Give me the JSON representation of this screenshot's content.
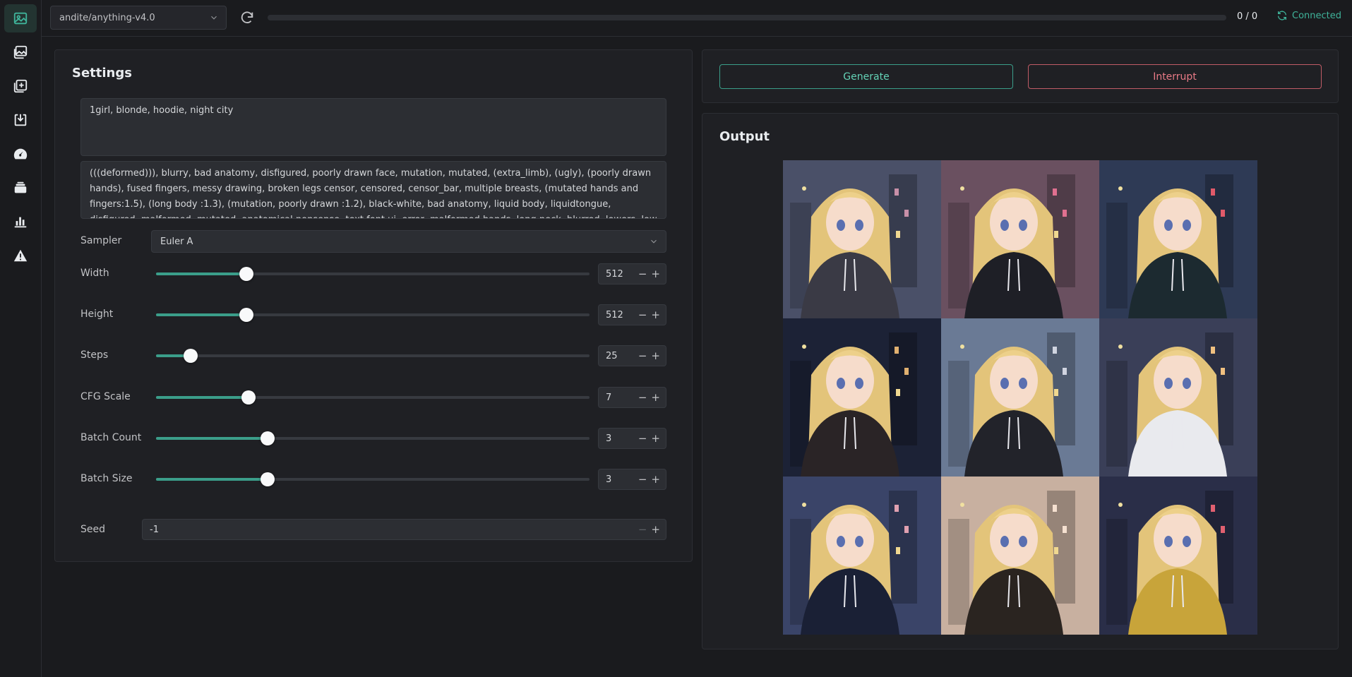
{
  "sidebar": {
    "items": [
      {
        "icon": "image-icon",
        "active": true
      },
      {
        "icon": "images-icon",
        "active": false
      },
      {
        "icon": "add-image-icon",
        "active": false
      },
      {
        "icon": "download-icon",
        "active": false
      },
      {
        "icon": "gauge-icon",
        "active": false
      },
      {
        "icon": "stack-icon",
        "active": false
      },
      {
        "icon": "bar-chart-icon",
        "active": false
      },
      {
        "icon": "warning-icon",
        "active": false
      }
    ]
  },
  "topbar": {
    "model": "andite/anything-v4.0",
    "progress_text": "0 / 0",
    "progress_value": 0,
    "status": "Connected"
  },
  "settings": {
    "title": "Settings",
    "prompt": "1girl, blonde, hoodie, night city",
    "negative_prompt": "(((deformed))), blurry, bad anatomy, disfigured, poorly drawn face, mutation, mutated, (extra_limb), (ugly), (poorly drawn hands), fused fingers, messy drawing, broken legs censor, censored, censor_bar, multiple breasts, (mutated hands and fingers:1.5), (long body :1.3), (mutation, poorly drawn :1.2), black-white, bad anatomy, liquid body, liquidtongue, disfigured, malformed, mutated, anatomical nonsense, text font ui, error, malformed hands, long neck, blurred, lowers, low res, bad anatomy",
    "sampler_label": "Sampler",
    "sampler_value": "Euler A",
    "sliders": [
      {
        "label": "Width",
        "value": "512",
        "fraction": 0.209
      },
      {
        "label": "Height",
        "value": "512",
        "fraction": 0.209
      },
      {
        "label": "Steps",
        "value": "25",
        "fraction": 0.08
      },
      {
        "label": "CFG Scale",
        "value": "7",
        "fraction": 0.214
      },
      {
        "label": "Batch Count",
        "value": "3",
        "fraction": 0.257
      },
      {
        "label": "Batch Size",
        "value": "3",
        "fraction": 0.257
      }
    ],
    "seed_label": "Seed",
    "seed_value": "-1",
    "minus": "−",
    "plus": "+"
  },
  "actions": {
    "generate": "Generate",
    "interrupt": "Interrupt",
    "generate_color": "#3b9e8a",
    "interrupt_color": "#c05b66"
  },
  "output": {
    "title": "Output",
    "images": [
      {
        "hoodie": "#3a3a45",
        "bg": "#4a5068",
        "accent": "#c890a8"
      },
      {
        "hoodie": "#1e1f26",
        "bg": "#6a5060",
        "accent": "#e07090"
      },
      {
        "hoodie": "#1c2a30",
        "bg": "#2e3a55",
        "accent": "#e05a6a"
      },
      {
        "hoodie": "#2a2426",
        "bg": "#1c2236",
        "accent": "#e0b070"
      },
      {
        "hoodie": "#22232a",
        "bg": "#6a7a95",
        "accent": "#d0d4e0"
      },
      {
        "hoodie": "#e9eaee",
        "bg": "#3a3f58",
        "accent": "#f0c080"
      },
      {
        "hoodie": "#1a2035",
        "bg": "#3a4468",
        "accent": "#e0a0b0"
      },
      {
        "hoodie": "#2a2420",
        "bg": "#c8b0a0",
        "accent": "#f5e0d0"
      },
      {
        "hoodie": "#c8a43a",
        "bg": "#2a2e48",
        "accent": "#e06070"
      }
    ]
  }
}
